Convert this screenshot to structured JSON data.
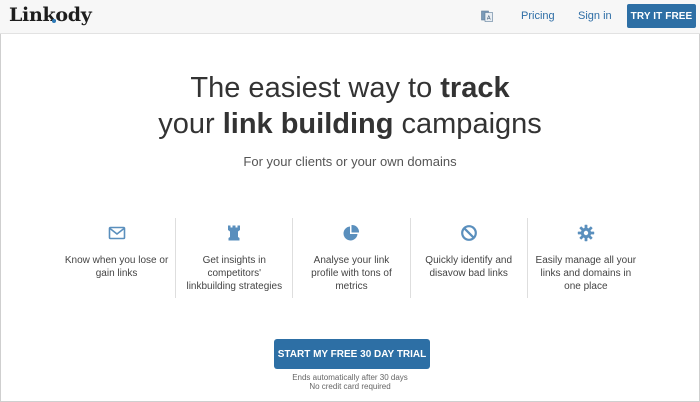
{
  "header": {
    "logo": "Linkody",
    "nav": {
      "pricing": "Pricing",
      "sign_in": "Sign in",
      "try_button": "TRY IT FREE"
    },
    "language_icon": "translate-icon"
  },
  "hero": {
    "line1_pre": "The easiest way to ",
    "line1_bold": "track",
    "line2_pre": "your ",
    "line2_bold": "link building",
    "line2_post": " campaigns",
    "subtitle": "For your clients or your own domains"
  },
  "features": [
    {
      "icon": "envelope-icon",
      "text": "Know when you lose or gain links"
    },
    {
      "icon": "chess-rook-icon",
      "text": "Get insights in competitors' linkbuilding strategies"
    },
    {
      "icon": "pie-chart-icon",
      "text": "Analyse your link profile with tons of metrics"
    },
    {
      "icon": "ban-icon",
      "text": "Quickly identify and disavow bad links"
    },
    {
      "icon": "gear-icon",
      "text": "Easily manage all your links and domains in one place"
    }
  ],
  "cta": {
    "label": "START MY FREE 30 DAY TRIAL",
    "note1": "Ends automatically after 30 days",
    "note2": "No credit card required"
  },
  "colors": {
    "accent": "#2d6fa5",
    "icon": "#5a8fbd"
  }
}
